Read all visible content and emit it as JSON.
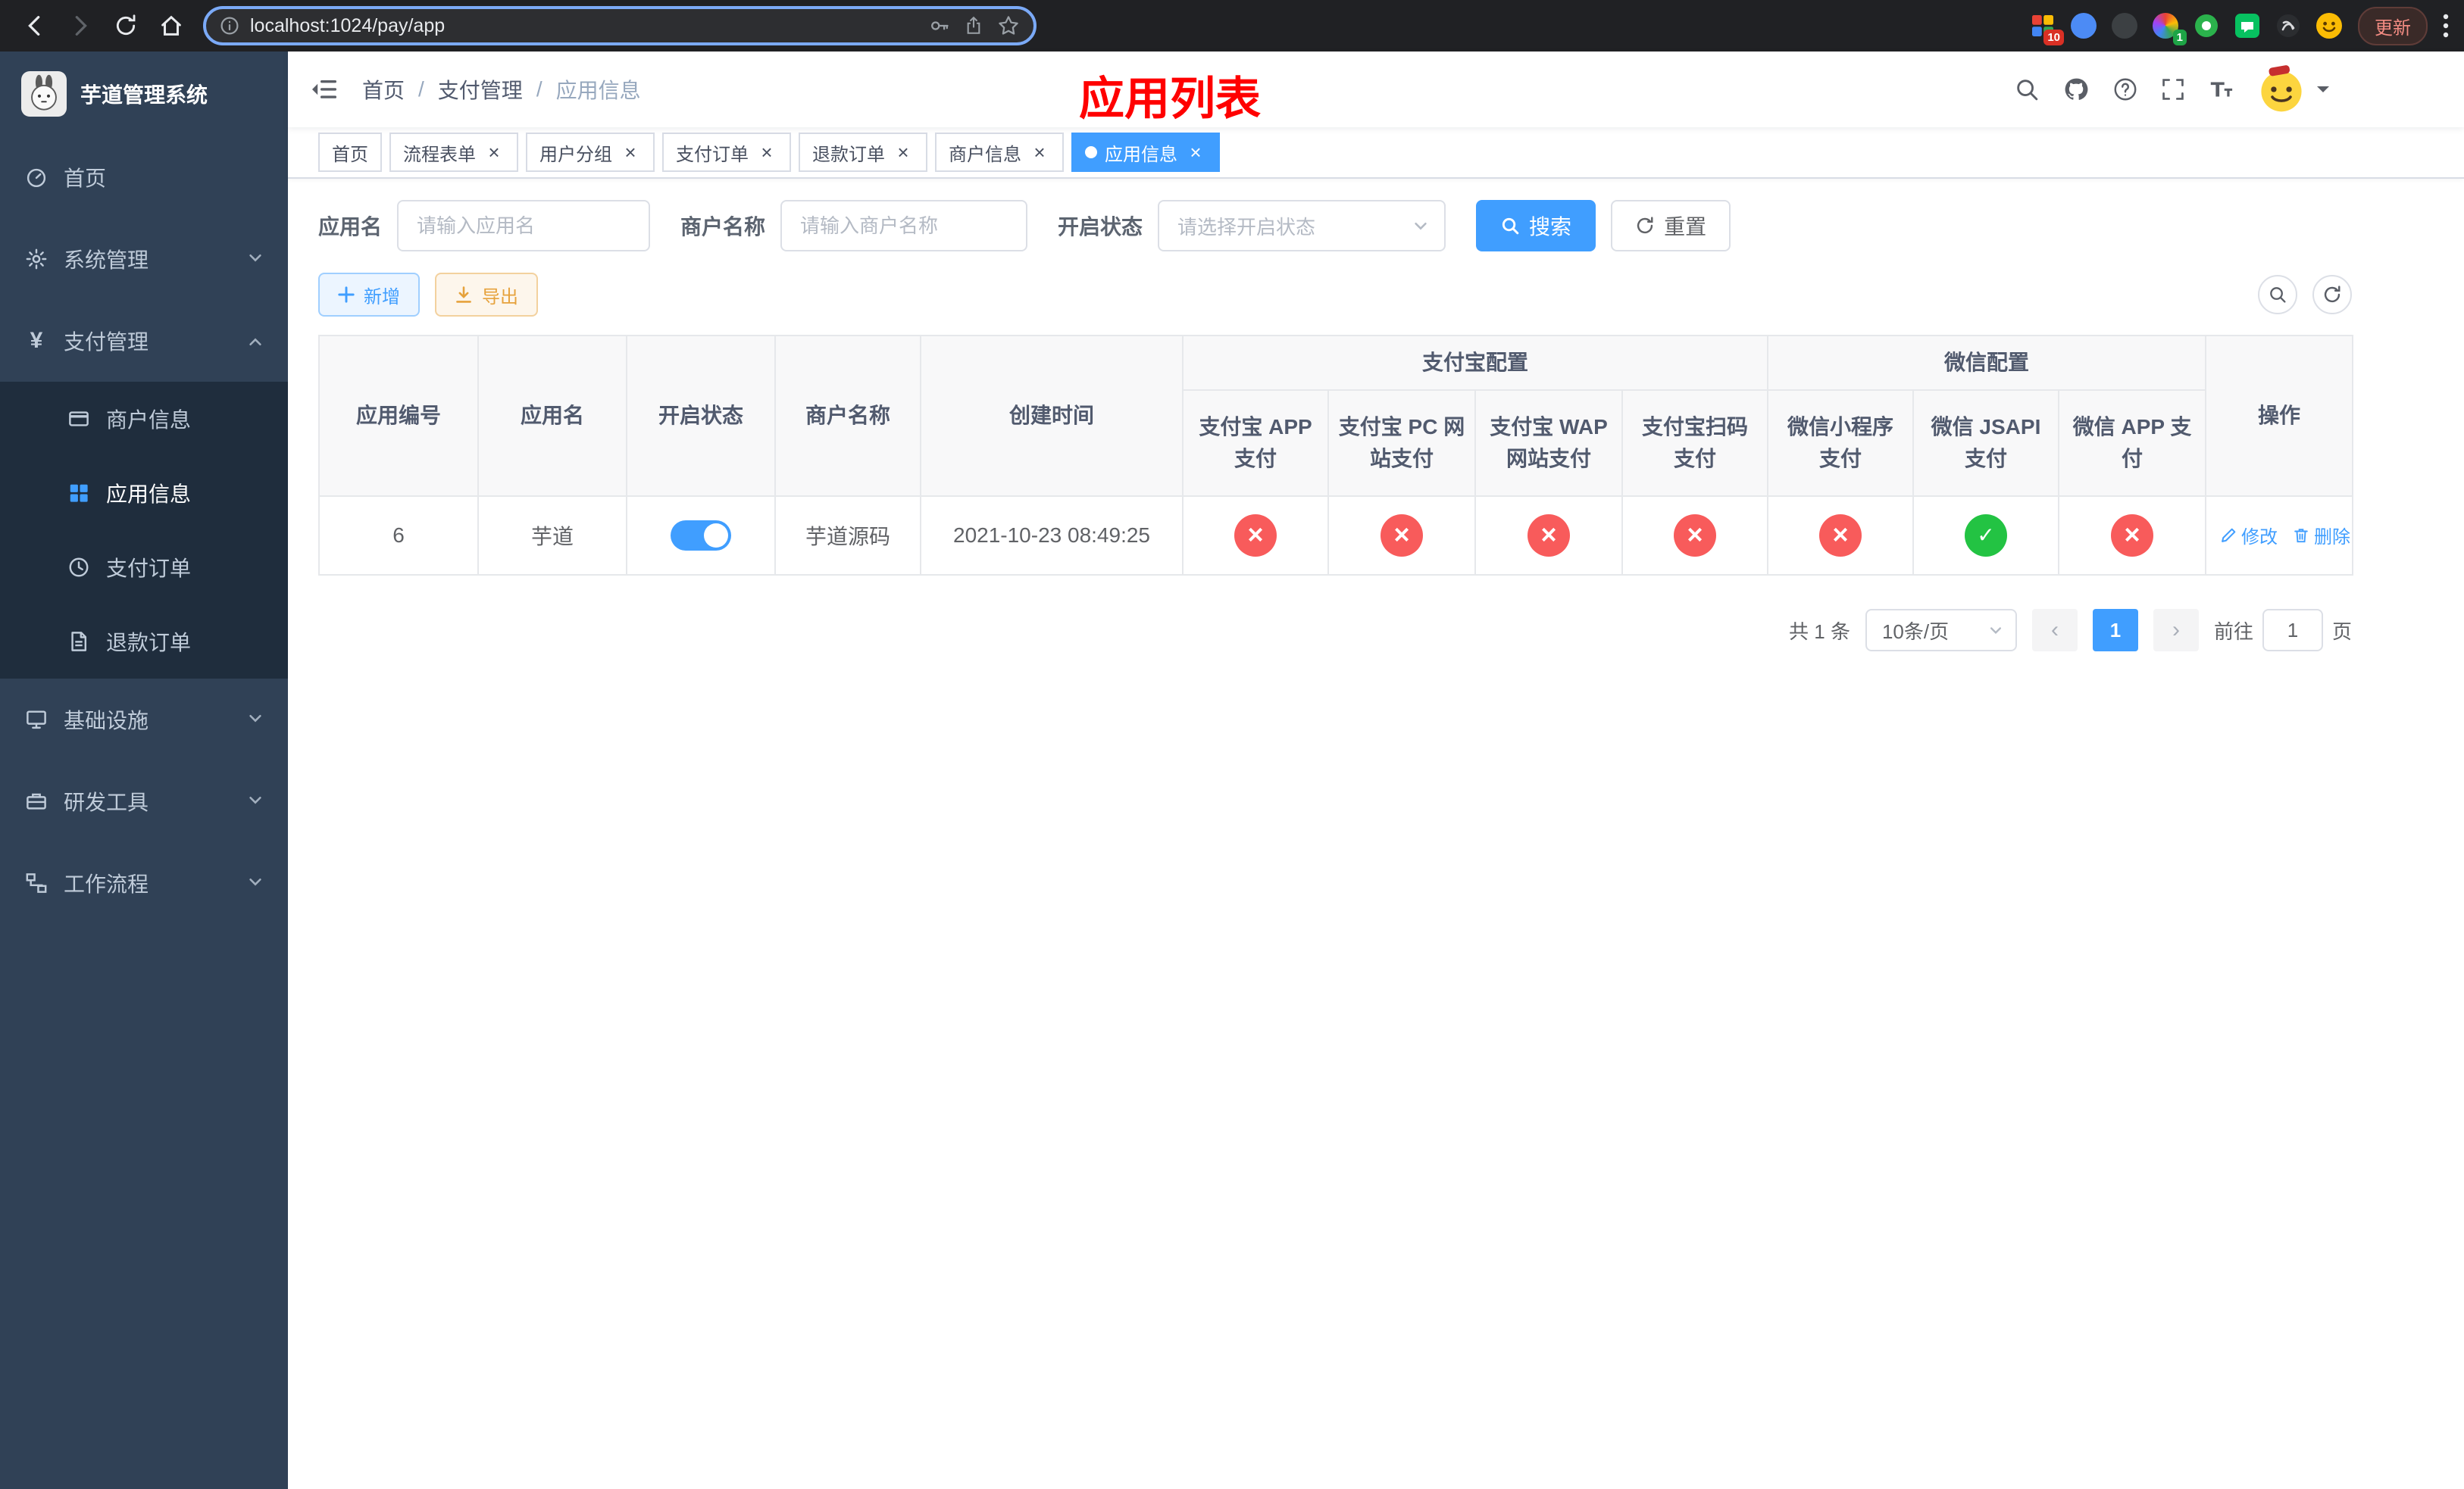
{
  "colors": {
    "primary": "#409EFF",
    "success_check": "#23c343",
    "danger_cross": "#f85b5b",
    "warning": "#e6a23c",
    "page_title_red": "#ff0000",
    "sidebar_bg": "#304156",
    "sidebar_submenu_bg": "#1f2d3d",
    "browser_bar_bg": "#202124"
  },
  "icons": {
    "yen": "¥"
  },
  "ui": {
    "close_glyph": "×",
    "prev_glyph": "‹",
    "next_glyph": "›"
  },
  "browser": {
    "url": "localhost:1024/pay/app",
    "update_label": "更新",
    "extensions": [
      {
        "badge": "10"
      },
      {
        "badge": ""
      },
      {
        "badge": ""
      },
      {
        "badge": "1"
      },
      {
        "badge": ""
      },
      {
        "badge": ""
      },
      {
        "badge": ""
      },
      {
        "badge": ""
      }
    ]
  },
  "sidebar": {
    "title": "芋道管理系统",
    "items": [
      {
        "label": "首页"
      },
      {
        "label": "系统管理"
      },
      {
        "label": "支付管理"
      },
      {
        "label": "基础设施"
      },
      {
        "label": "研发工具"
      },
      {
        "label": "工作流程"
      }
    ],
    "payment_children": [
      {
        "label": "商户信息",
        "active": false
      },
      {
        "label": "应用信息",
        "active": true
      },
      {
        "label": "支付订单",
        "active": false
      },
      {
        "label": "退款订单",
        "active": false
      }
    ]
  },
  "header": {
    "breadcrumb": [
      "首页",
      "支付管理",
      "应用信息"
    ],
    "separator": "/",
    "page_title": "应用列表"
  },
  "tabs": [
    {
      "label": "首页",
      "closable": false,
      "active": false
    },
    {
      "label": "流程表单",
      "closable": true,
      "active": false
    },
    {
      "label": "用户分组",
      "closable": true,
      "active": false
    },
    {
      "label": "支付订单",
      "closable": true,
      "active": false
    },
    {
      "label": "退款订单",
      "closable": true,
      "active": false
    },
    {
      "label": "商户信息",
      "closable": true,
      "active": false
    },
    {
      "label": "应用信息",
      "closable": true,
      "active": true
    }
  ],
  "filters": {
    "app_name": {
      "label": "应用名",
      "placeholder": "请输入应用名",
      "value": ""
    },
    "merchant_name": {
      "label": "商户名称",
      "placeholder": "请输入商户名称",
      "value": ""
    },
    "status": {
      "label": "开启状态",
      "placeholder": "请选择开启状态",
      "value": ""
    },
    "search": "搜索",
    "reset": "重置"
  },
  "toolbar": {
    "add": "新增",
    "export": "导出"
  },
  "table": {
    "groups": {
      "alipay": "支付宝配置",
      "wechat": "微信配置"
    },
    "columns": {
      "id": "应用编号",
      "name": "应用名",
      "status": "开启状态",
      "merchant": "商户名称",
      "created": "创建时间",
      "alipay_app": "支付宝 APP 支付",
      "alipay_pc": "支付宝 PC 网站支付",
      "alipay_wap": "支付宝 WAP 网站支付",
      "alipay_qr": "支付宝扫码支付",
      "wx_lite": "微信小程序支付",
      "wx_jsapi": "微信 JSAPI 支付",
      "wx_app": "微信 APP 支付",
      "ops": "操作"
    },
    "rows": [
      {
        "id": "6",
        "name": "芋道",
        "status_on": true,
        "merchant": "芋道源码",
        "created": "2021-10-23 08:49:25",
        "alipay_app": false,
        "alipay_pc": false,
        "alipay_wap": false,
        "alipay_qr": false,
        "wx_lite": false,
        "wx_jsapi": true,
        "wx_app": false
      }
    ],
    "edit": "修改",
    "delete": "删除"
  },
  "pagination": {
    "total": "共 1 条",
    "page_size": "10条/页",
    "page": "1",
    "goto": "前往",
    "goto_value": "1",
    "unit": "页"
  }
}
